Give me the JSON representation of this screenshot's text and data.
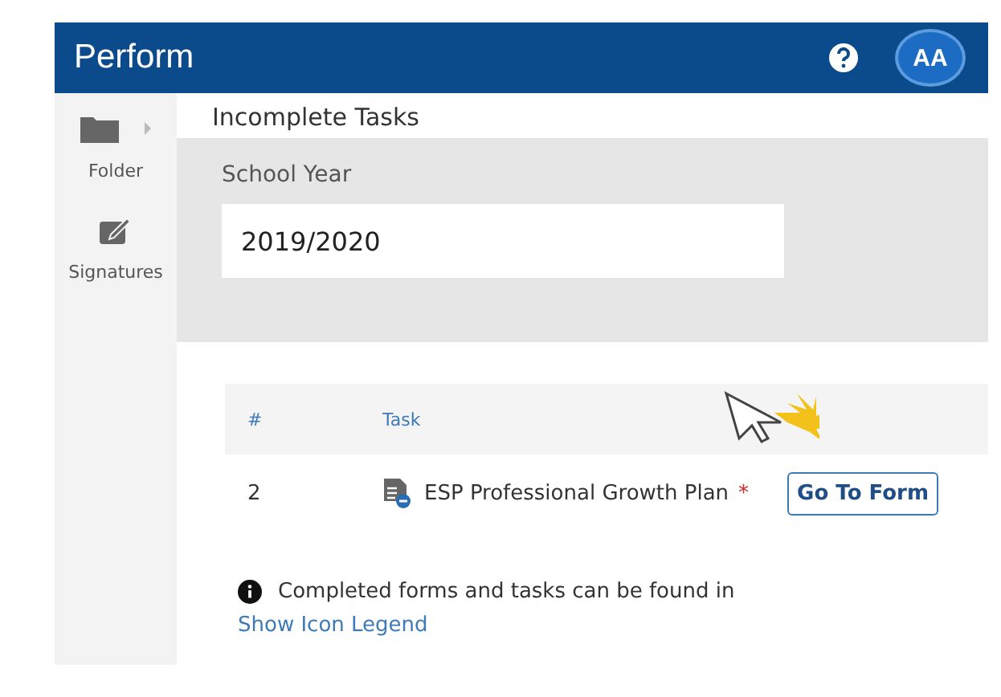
{
  "header": {
    "logo": "Perform",
    "avatar": "AA"
  },
  "sidebar": {
    "items": [
      {
        "kind": "folder",
        "label": "Folder",
        "expandable": true
      },
      {
        "kind": "signatures",
        "label": "Signatures",
        "expandable": false
      }
    ]
  },
  "page": {
    "title": "Incomplete Tasks"
  },
  "filter": {
    "label": "School Year",
    "value": "2019/2020"
  },
  "table": {
    "columns": [
      "#",
      "Task"
    ],
    "rows": [
      {
        "number": "2",
        "task": "ESP Professional Growth Plan",
        "required_mark": "*",
        "action": "Go To Form"
      }
    ]
  },
  "info": {
    "text": "Completed forms and tasks can be found in",
    "link": "Show Icon Legend"
  }
}
